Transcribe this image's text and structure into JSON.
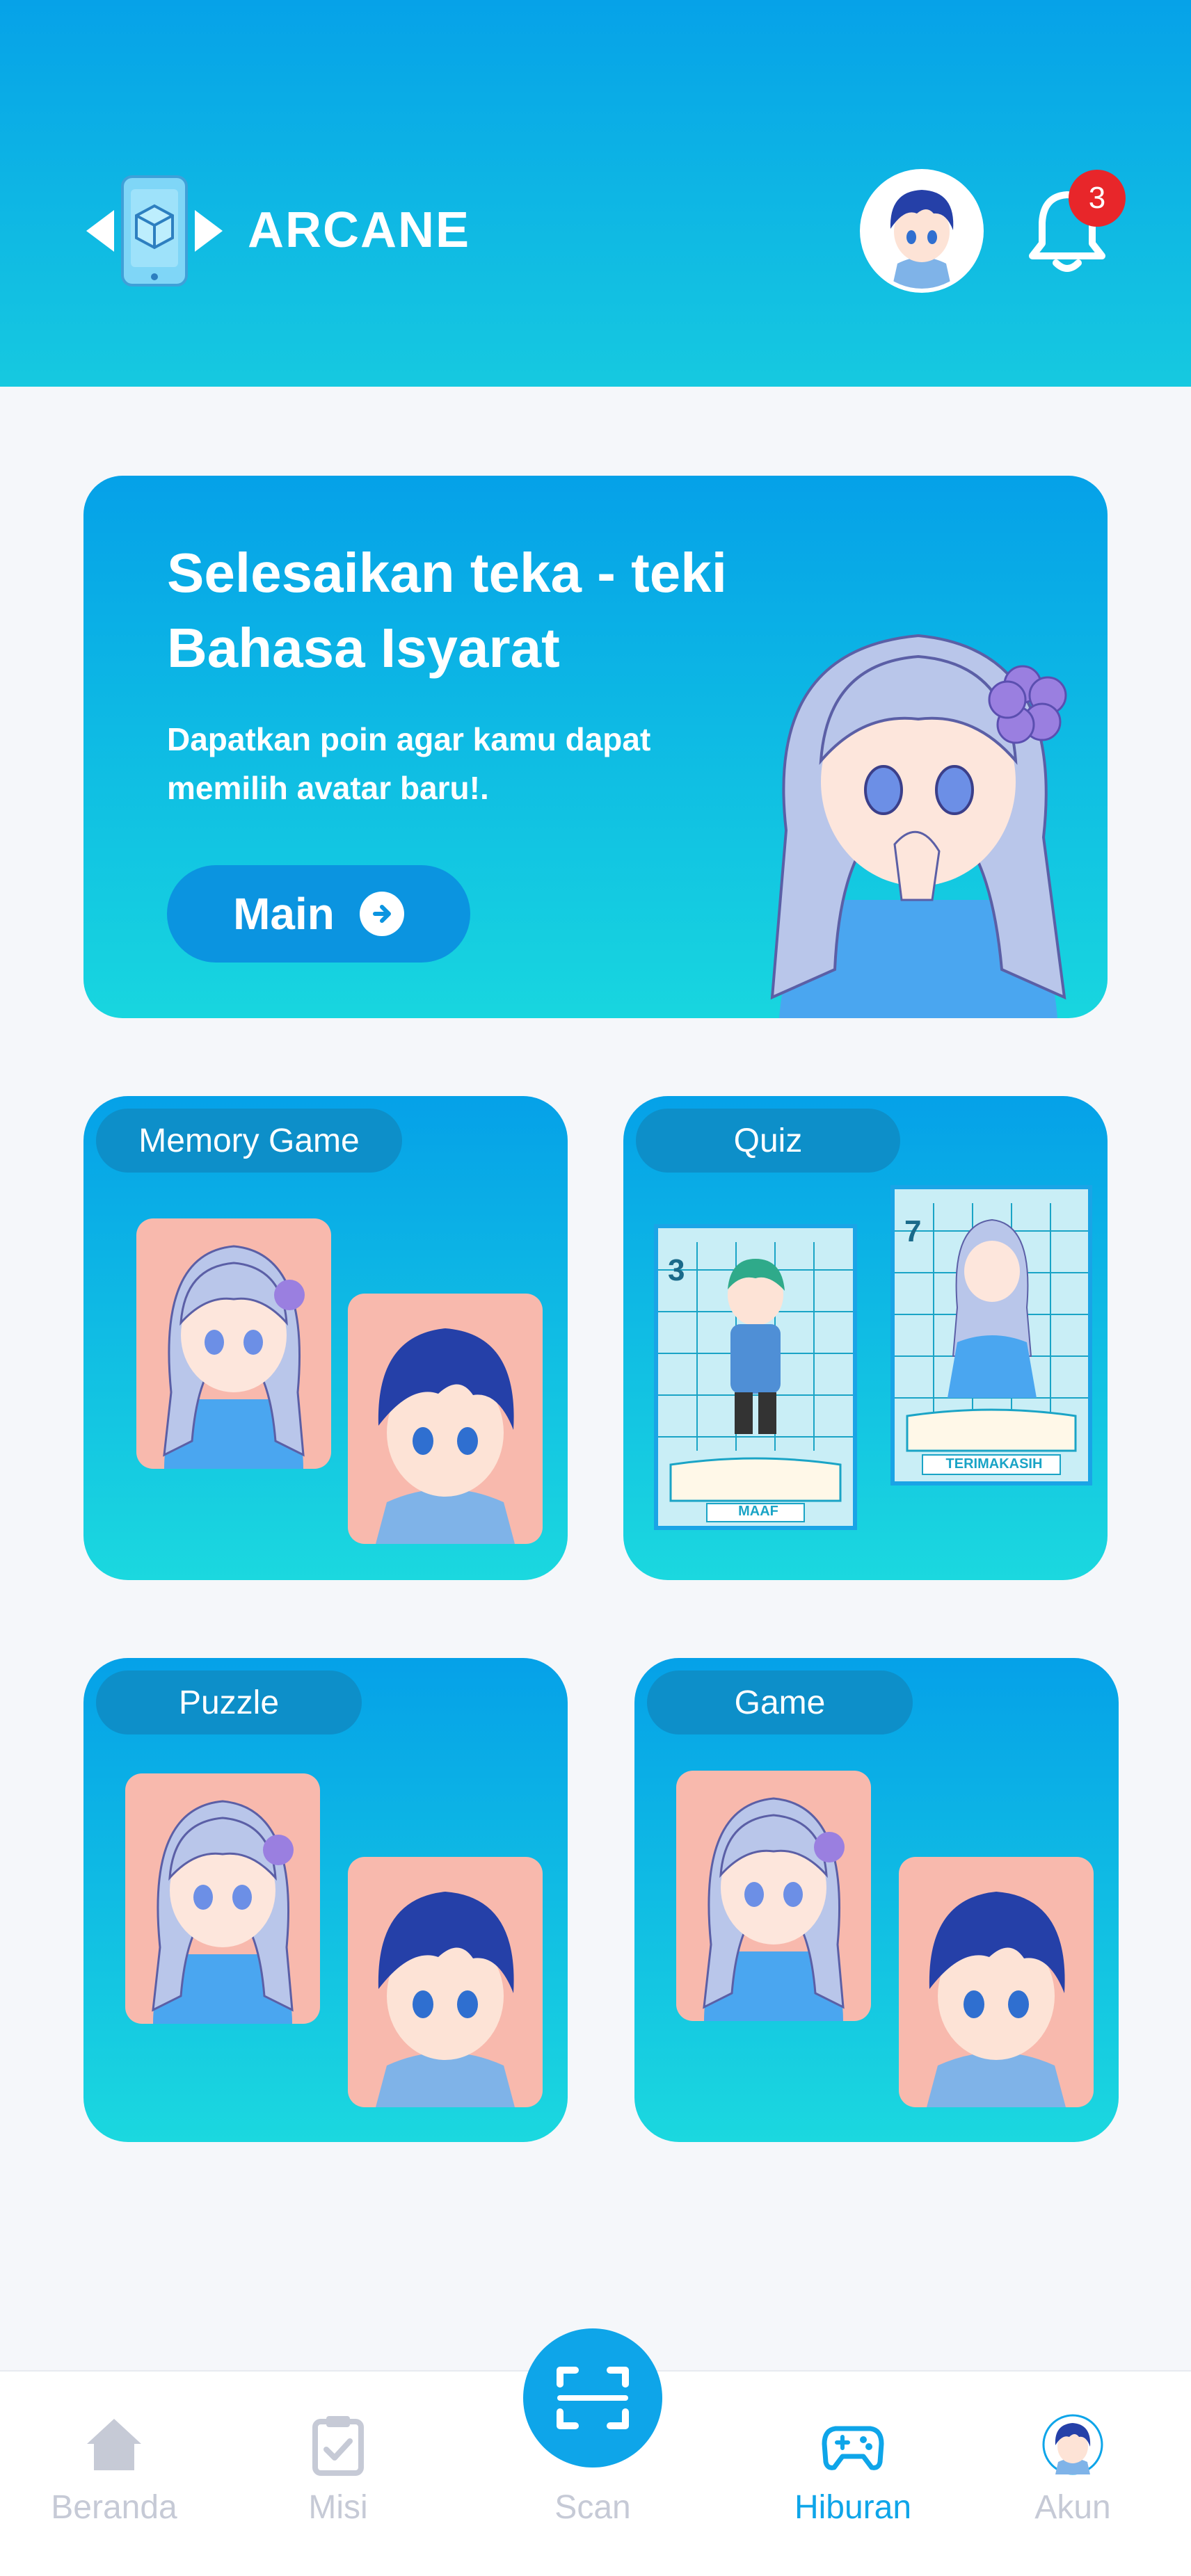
{
  "header": {
    "brand": "ARCANE",
    "notification_count": "3"
  },
  "hero": {
    "title": "Selesaikan teka - teki Bahasa Isyarat",
    "subtitle": "Dapatkan poin agar kamu dapat memilih avatar baru!.",
    "button_label": "Main"
  },
  "cards": [
    {
      "label": "Memory Game"
    },
    {
      "label": "Quiz"
    },
    {
      "label": "Puzzle"
    },
    {
      "label": "Game"
    }
  ],
  "quiz_cards": [
    {
      "number": "3",
      "caption": "MAAF"
    },
    {
      "number": "7",
      "caption": "TERIMAKASIH"
    }
  ],
  "nav": [
    {
      "label": "Beranda",
      "icon": "home-icon"
    },
    {
      "label": "Misi",
      "icon": "clipboard-icon"
    },
    {
      "label": "Scan",
      "icon": "scan-icon"
    },
    {
      "label": "Hiburan",
      "icon": "gamepad-icon"
    },
    {
      "label": "Akun",
      "icon": "avatar-icon"
    }
  ],
  "colors": {
    "primary": "#0ea5e9",
    "header_top": "#06a2e8",
    "header_bottom": "#16c9e0",
    "tile": "#f8b9ad",
    "badge": "#e8262a",
    "inactive": "#c6cad6"
  }
}
